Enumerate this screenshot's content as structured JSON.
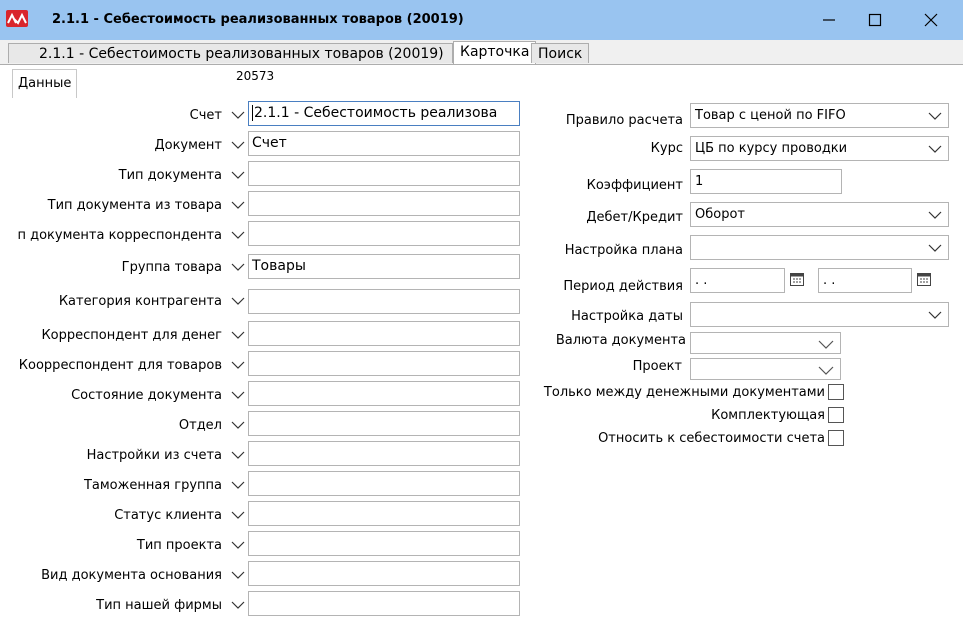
{
  "window": {
    "title": "2.1.1 - Себестоимость реализованных товаров (20019)"
  },
  "tabs": [
    "2.1.1 - Себестоимость реализованных товаров (20019)",
    "Карточка",
    "Поиск"
  ],
  "subtab": "Данные",
  "record_code": "20573",
  "left_fields": [
    {
      "label": "Счет",
      "value": "2.1.1 - Себестоимость реализова"
    },
    {
      "label": "Документ",
      "value": "Счет"
    },
    {
      "label": "Тип документа",
      "value": ""
    },
    {
      "label": "Тип документа из товара",
      "value": ""
    },
    {
      "label": "Тип документа корреспондента",
      "value": ""
    },
    {
      "label": "Группа товара",
      "value": "Товары"
    },
    {
      "label": "Категория контрагента",
      "value": ""
    },
    {
      "label": "Корреспондент для денег",
      "value": ""
    },
    {
      "label": "Коорреспондент для товаров",
      "value": ""
    },
    {
      "label": "Состояние документа",
      "value": ""
    },
    {
      "label": "Отдел",
      "value": ""
    },
    {
      "label": "Настройки из счета",
      "value": ""
    },
    {
      "label": "Таможенная группа",
      "value": ""
    },
    {
      "label": "Статус клиента",
      "value": ""
    },
    {
      "label": "Тип проекта",
      "value": ""
    },
    {
      "label": "Вид документа основания",
      "value": ""
    },
    {
      "label": "Тип нашей фирмы",
      "value": ""
    }
  ],
  "right": {
    "rule_label": "Правило расчета",
    "rule_value": "Товар с ценой по FIFO",
    "rate_label": "Курс",
    "rate_value": "ЦБ по курсу проводки",
    "coef_label": "Коэффициент",
    "coef_value": "1",
    "dc_label": "Дебет/Кредит",
    "dc_value": "Оборот",
    "plan_label": "Настройка плана",
    "plan_value": "",
    "period_label": "Период действия",
    "period_from": " .  .",
    "period_to": " .  .",
    "date_label": "Настройка даты",
    "date_value": "",
    "currency_label": "Валюта документа",
    "currency_value": "",
    "project_label": "Проект",
    "project_value": "",
    "only_money_label": "Только между денежными документами",
    "only_money_checked": false,
    "component_label": "Комплектующая",
    "component_checked": false,
    "cost_label": "Относить к себестоимости счета",
    "cost_checked": false
  }
}
